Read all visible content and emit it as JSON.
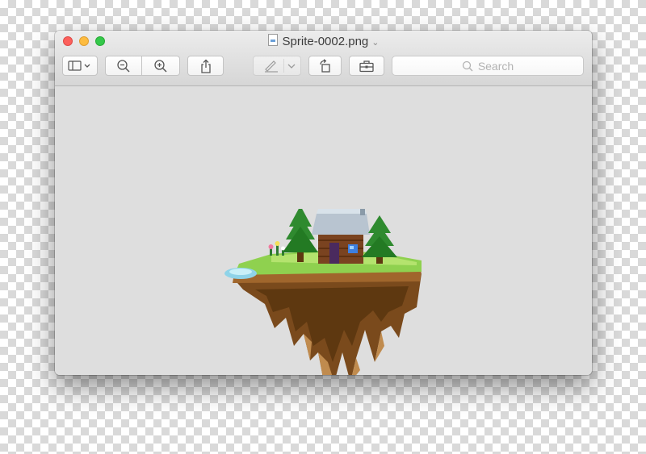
{
  "window": {
    "title": "Sprite-0002.png",
    "title_icon": "document-icon",
    "title_chevron": "chevron-down-icon"
  },
  "toolbar": {
    "buttons": [
      {
        "name": "sidebar-toggle",
        "icon": "sidebar-icon"
      },
      {
        "name": "zoom-out",
        "icon": "zoom-out-icon"
      },
      {
        "name": "zoom-in",
        "icon": "zoom-in-icon"
      },
      {
        "name": "share",
        "icon": "share-icon"
      },
      {
        "name": "markup",
        "icon": "pen-icon",
        "enabled": false
      },
      {
        "name": "rotate",
        "icon": "rotate-left-icon"
      },
      {
        "name": "toolbox",
        "icon": "toolbox-icon"
      }
    ],
    "search": {
      "placeholder": "Search",
      "icon": "search-icon"
    }
  },
  "image": {
    "description_label": "",
    "colors": {
      "grass": "#8fd14f",
      "dirt": "#7a4a1c",
      "tree": "#2f8a2f",
      "water": "#8fd3e8",
      "roof": "#b8c4d0",
      "cabin": "#7a4320"
    }
  }
}
